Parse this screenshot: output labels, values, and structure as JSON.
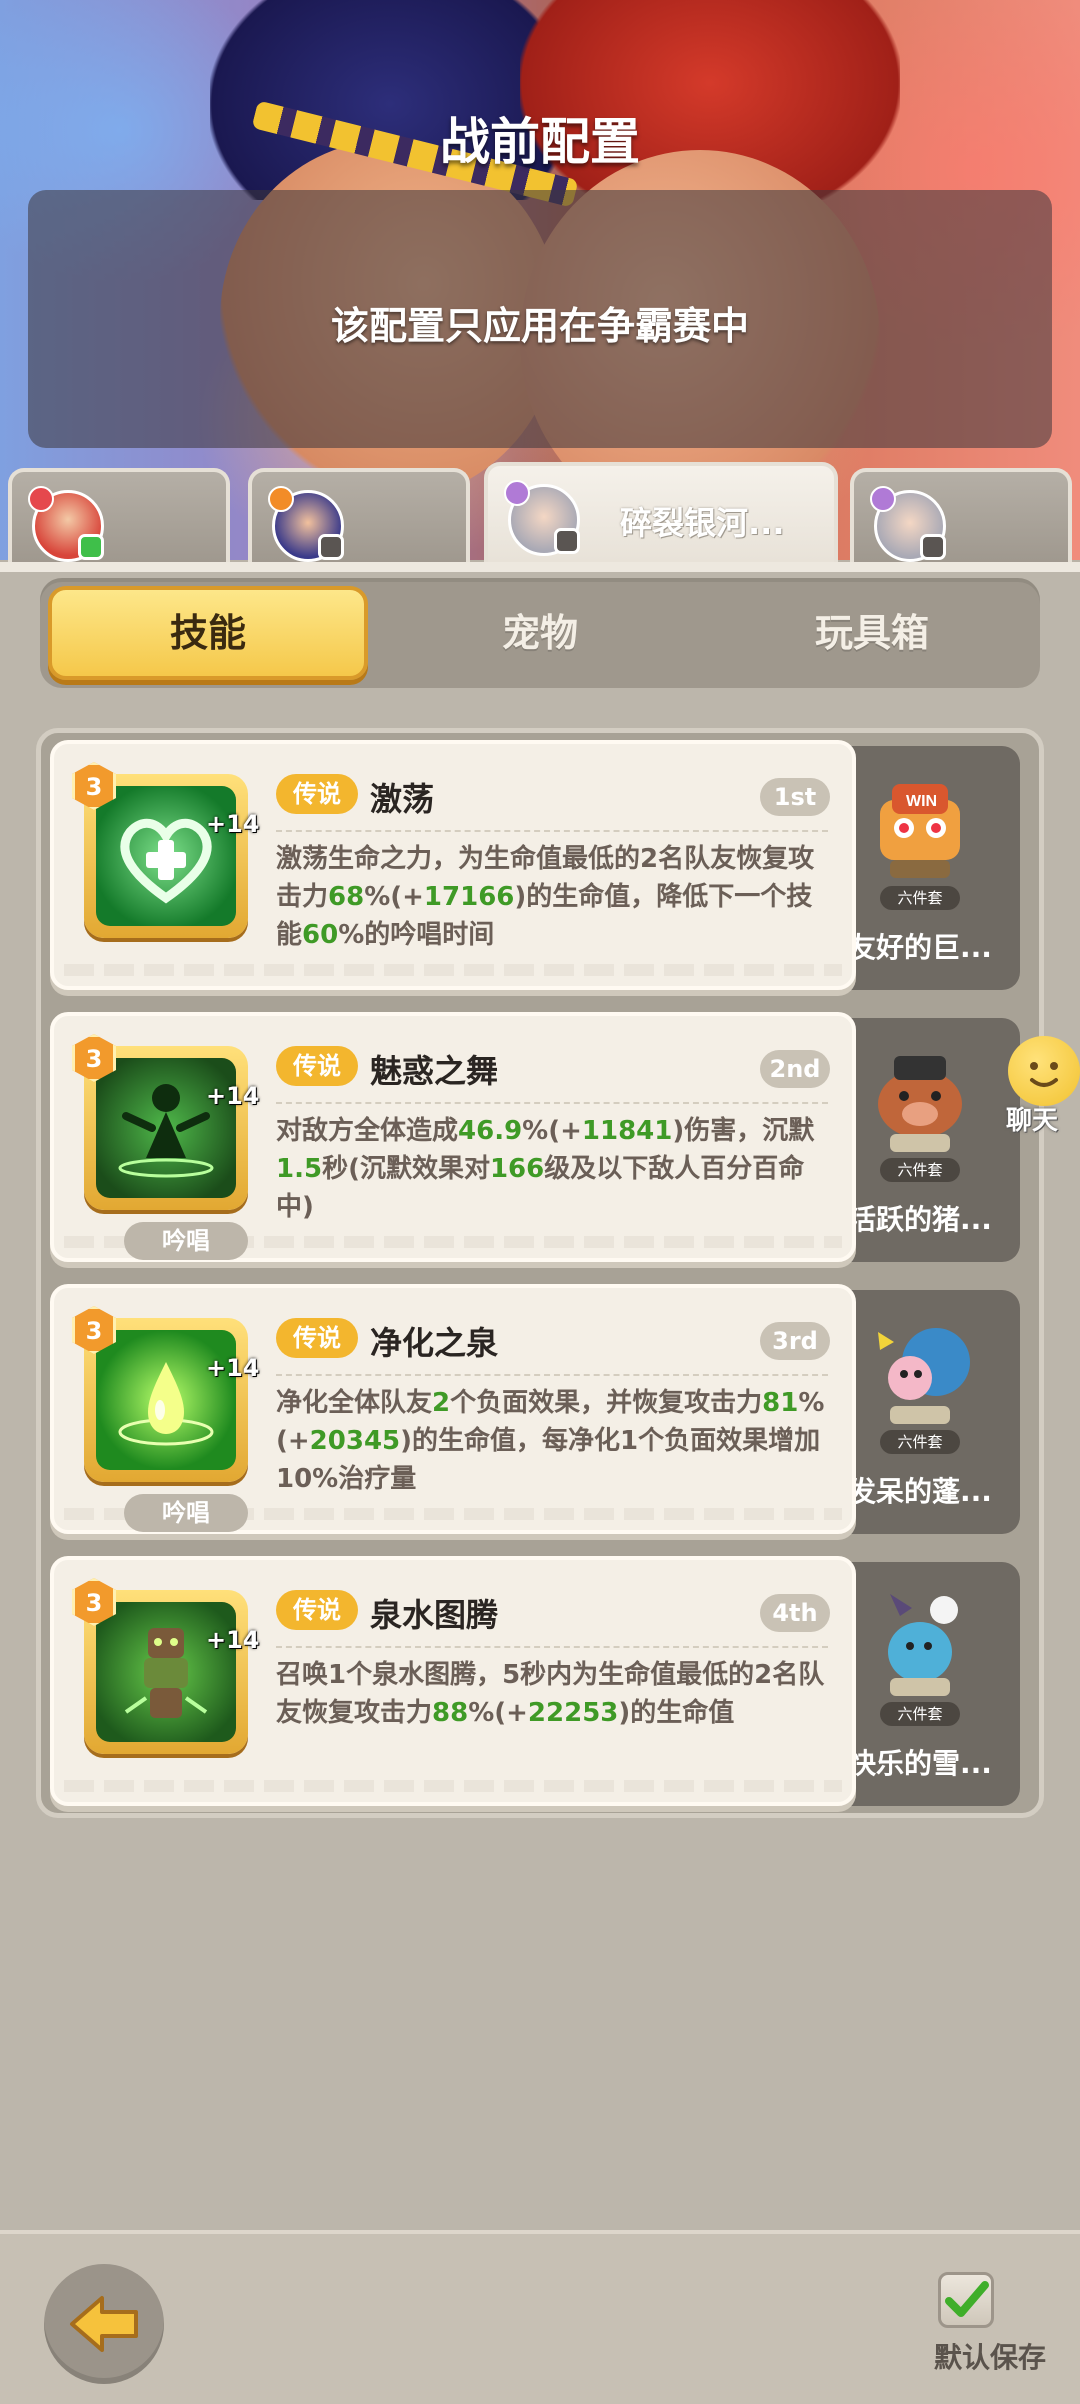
{
  "header": {
    "title": "战前配置",
    "notice": "该配置只应用在争霸赛中"
  },
  "hero_tabs": [
    {
      "name": "",
      "selected": false,
      "element_color": "#e5484d",
      "badge_color": "#3fbf4a"
    },
    {
      "name": "",
      "selected": false,
      "element_color": "#f28c28",
      "badge_color": "#5a5552"
    },
    {
      "name": "碎裂银河...",
      "selected": true,
      "element_color": "#b07ad6",
      "badge_color": "#5a5552"
    },
    {
      "name": "",
      "selected": false,
      "element_color": "#b07ad6",
      "badge_color": "#5a5552"
    }
  ],
  "segment_tabs": {
    "skills": "技能",
    "pets": "宠物",
    "toybox": "玩具箱",
    "active": "skills"
  },
  "skills": [
    {
      "level": "3",
      "plus": "+14",
      "rarity": "传说",
      "name": "激荡",
      "rank": "1st",
      "cast_tag": "",
      "icon": "heart-plus-icon",
      "desc": [
        "激荡生命之力，为生命值最低的2名队友恢复攻击力",
        "68",
        "%(+",
        "17166",
        ")的生命值，降低下一个技能",
        "60",
        "%的吟唱时间"
      ],
      "pet_name": "友好的巨...",
      "pet_set": "六件套",
      "pet_icon": "robot-pet-icon"
    },
    {
      "level": "3",
      "plus": "+14",
      "rarity": "传说",
      "name": "魅惑之舞",
      "rank": "2nd",
      "cast_tag": "吟唱",
      "icon": "dancer-icon",
      "desc": [
        "对敌方全体造成",
        "46.9",
        "%(+",
        "11841",
        ")伤害，沉默",
        "1.5",
        "秒(沉默效果对",
        "166",
        "级及以下敌人百分百命中)"
      ],
      "pet_name": "活跃的猪...",
      "pet_set": "六件套",
      "pet_icon": "boar-pet-icon"
    },
    {
      "level": "3",
      "plus": "+14",
      "rarity": "传说",
      "name": "净化之泉",
      "rank": "3rd",
      "cast_tag": "吟唱",
      "icon": "water-drop-icon",
      "desc": [
        "净化全体队友",
        "2",
        "个负面效果，并恢复攻击力",
        "81",
        "%(+",
        "20345",
        ")的生命值，每净化1个负面效果增加10%治疗量"
      ],
      "pet_name": "发呆的蓬...",
      "pet_set": "六件套",
      "pet_icon": "fluffy-pet-icon"
    },
    {
      "level": "3",
      "plus": "+14",
      "rarity": "传说",
      "name": "泉水图腾",
      "rank": "4th",
      "cast_tag": "",
      "icon": "totem-icon",
      "desc": [
        "召唤1个泉水图腾，5秒内为生命值最低的2名队友恢复攻击力",
        "88",
        "%(+",
        "22253",
        ")的生命值"
      ],
      "pet_name": "快乐的雪...",
      "pet_set": "六件套",
      "pet_icon": "snow-pet-icon"
    }
  ],
  "chat": {
    "label": "聊天"
  },
  "footer": {
    "save_label": "默认保存",
    "save_checked": true
  },
  "colors": {
    "highlight": "#3f9a26",
    "rarity": "#f3b62e",
    "active_tab": "#f5c84a"
  }
}
